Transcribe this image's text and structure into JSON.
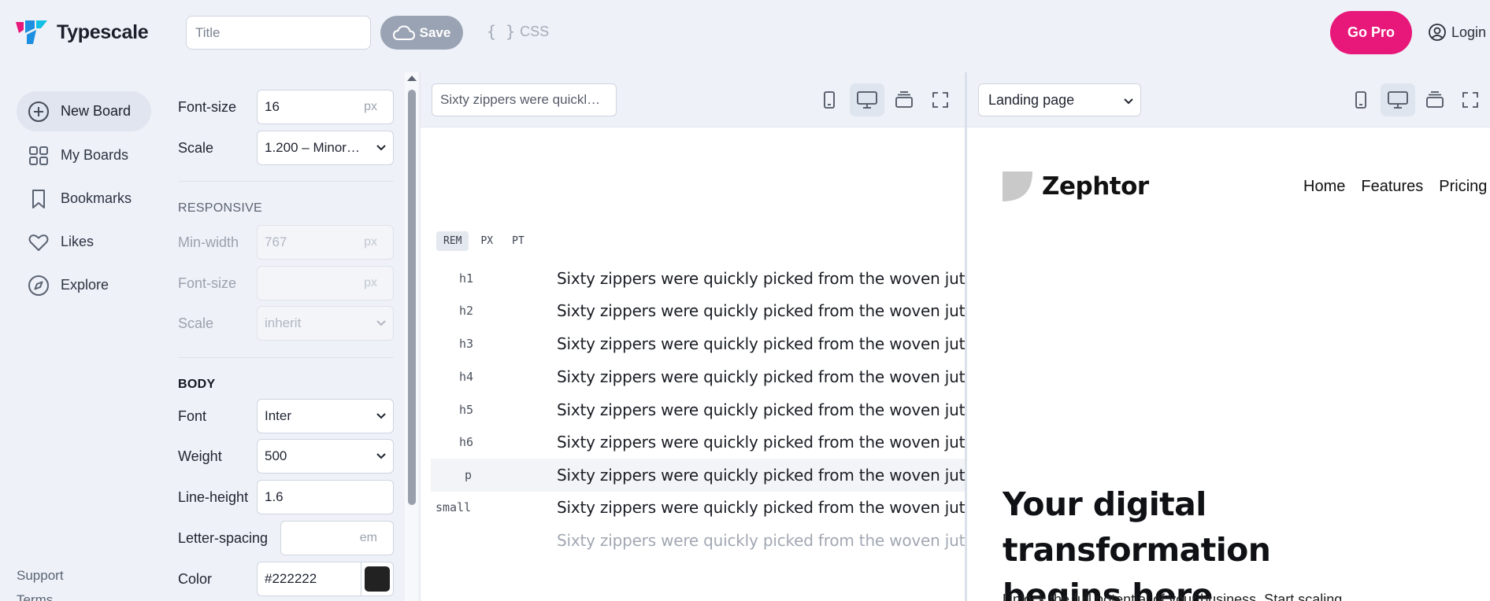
{
  "app": {
    "name": "Typescale"
  },
  "topbar": {
    "title_placeholder": "Title",
    "save_label": "Save",
    "css_label": "CSS",
    "gopro_label": "Go Pro",
    "login_label": "Login"
  },
  "nav": {
    "items": [
      {
        "label": "New Board",
        "icon": "plus-circle-icon",
        "active": true
      },
      {
        "label": "My Boards",
        "icon": "grid-icon",
        "active": false
      },
      {
        "label": "Bookmarks",
        "icon": "bookmark-icon",
        "active": false
      },
      {
        "label": "Likes",
        "icon": "heart-icon",
        "active": false
      },
      {
        "label": "Explore",
        "icon": "compass-icon",
        "active": false
      }
    ],
    "support_label": "Support",
    "terms_label": "Terms"
  },
  "settings": {
    "font_size_label": "Font-size",
    "font_size_value": "16",
    "font_size_unit": "px",
    "scale_label": "Scale",
    "scale_value": "1.200 – Minor…",
    "responsive_heading": "RESPONSIVE",
    "min_width_label": "Min-width",
    "min_width_value": "767",
    "min_width_unit": "px",
    "resp_font_size_label": "Font-size",
    "resp_font_size_unit": "px",
    "resp_scale_label": "Scale",
    "resp_scale_value": "inherit",
    "body_heading": "BODY",
    "font_label": "Font",
    "font_value": "Inter",
    "weight_label": "Weight",
    "weight_value": "500",
    "line_height_label": "Line-height",
    "line_height_value": "1.6",
    "letter_spacing_label": "Letter-spacing",
    "letter_spacing_unit": "em",
    "color_label": "Color",
    "color_value": "#222222"
  },
  "preview": {
    "sample_text": "Sixty zippers were quickl…",
    "unit_tabs": [
      "REM",
      "PX",
      "PT"
    ],
    "active_unit": "REM",
    "rows": [
      {
        "tag": "h1",
        "text": "Sixty zippers were quickly picked from the woven jute bag."
      },
      {
        "tag": "h2",
        "text": "Sixty zippers were quickly picked from the woven jute bag."
      },
      {
        "tag": "h3",
        "text": "Sixty zippers were quickly picked from the woven jute bag."
      },
      {
        "tag": "h4",
        "text": "Sixty zippers were quickly picked from the woven jute bag."
      },
      {
        "tag": "h5",
        "text": "Sixty zippers were quickly picked from the woven jute bag."
      },
      {
        "tag": "h6",
        "text": "Sixty zippers were quickly picked from the woven jute bag."
      },
      {
        "tag": "p",
        "text": "Sixty zippers were quickly picked from the woven jute bag."
      },
      {
        "tag": "small",
        "text": "Sixty zippers were quickly picked from the woven jute bag."
      },
      {
        "tag": "",
        "text": "Sixty zippers were quickly picked from the woven jute bag."
      }
    ]
  },
  "landing": {
    "page_select": "Landing page",
    "brand": "Zephtor",
    "nav": [
      "Home",
      "Features",
      "Pricing"
    ],
    "hero_line1": "Your digital transformation",
    "hero_line2": "begins here",
    "hero_sub": "Unlock the full potential of your business. Start scaling"
  },
  "colors": {
    "accent": "#e8177a",
    "save_bg": "#9aa3b4",
    "swatch": "#222222"
  }
}
